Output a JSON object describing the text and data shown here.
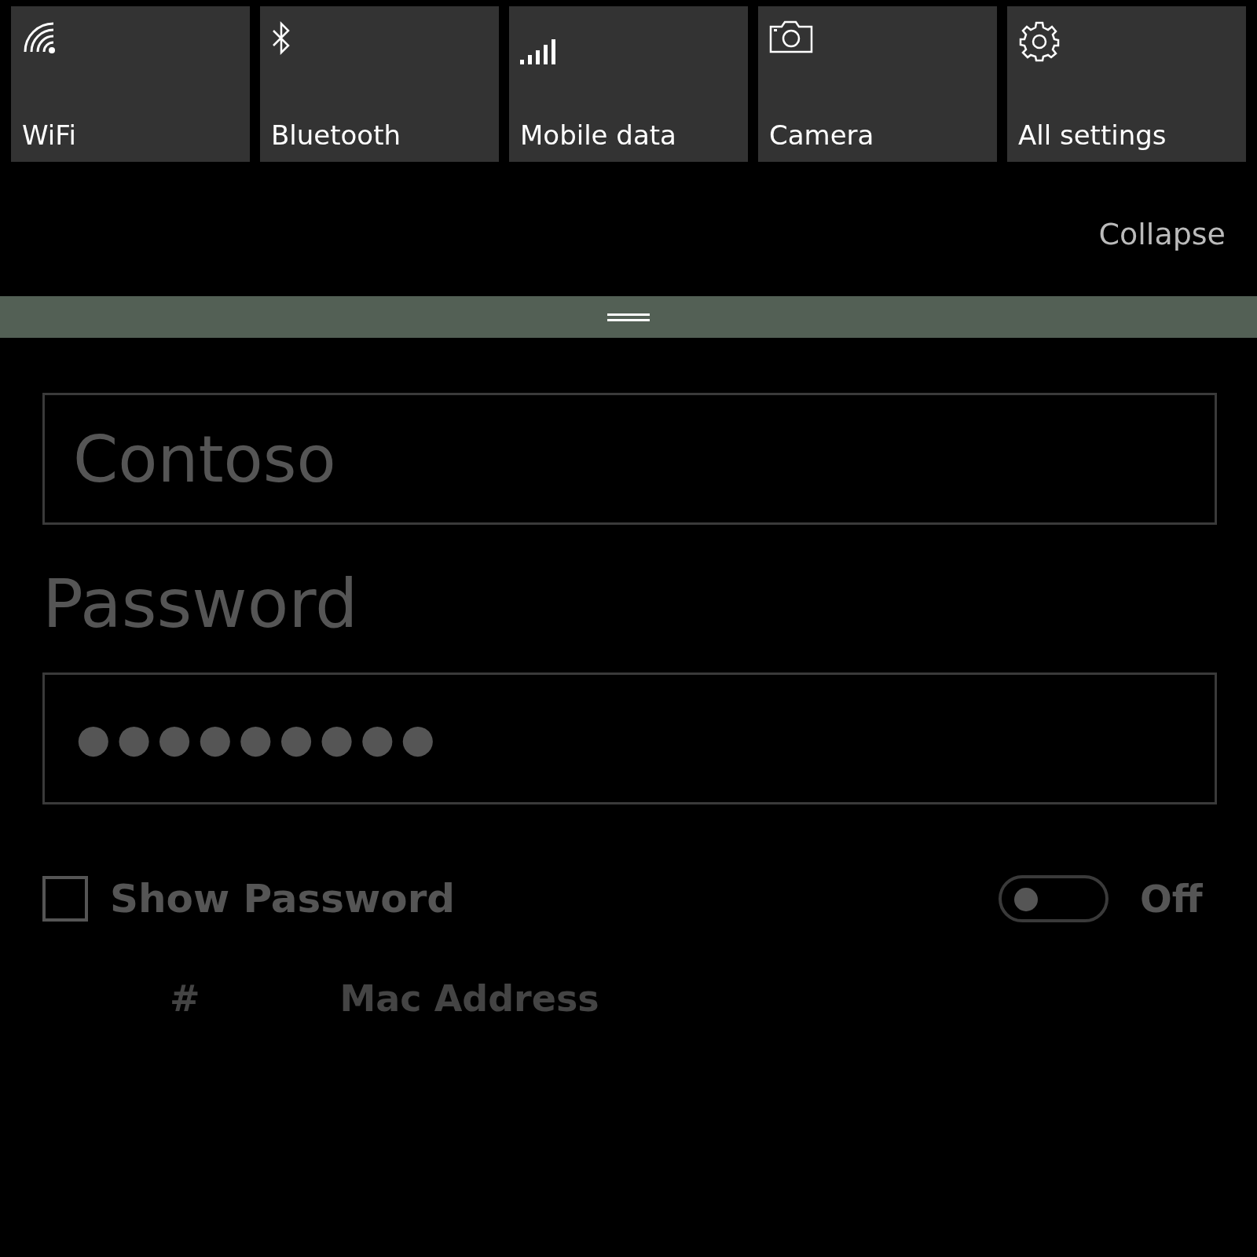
{
  "quick_actions": [
    {
      "label": "WiFi",
      "kind": "wifi"
    },
    {
      "label": "Bluetooth",
      "kind": "bluetooth"
    },
    {
      "label": "Mobile data",
      "kind": "signal"
    },
    {
      "label": "Camera",
      "kind": "camera"
    },
    {
      "label": "All settings",
      "kind": "settings"
    }
  ],
  "collapse_link": "Collapse",
  "form": {
    "ssid_value": "Contoso",
    "password_label": "Password",
    "password_value": "●●●●●●●●●",
    "show_password": {
      "label": "Show Password",
      "checked": false
    },
    "toggle": {
      "on": false,
      "label": "Off"
    }
  },
  "table": {
    "columns": [
      "#",
      "Mac Address"
    ]
  }
}
